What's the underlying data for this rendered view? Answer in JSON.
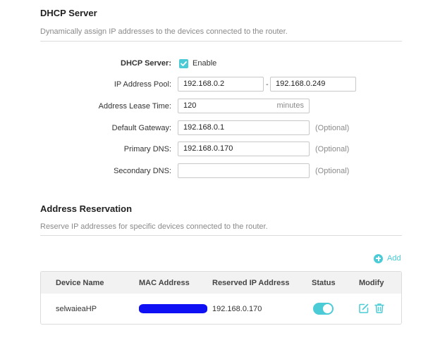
{
  "dhcp": {
    "title": "DHCP Server",
    "description": "Dynamically assign IP addresses to the devices connected to the router.",
    "server_label": "DHCP Server:",
    "enable_label": "Enable",
    "enabled": true,
    "pool_label": "IP Address Pool:",
    "pool_start": "192.168.0.2",
    "pool_dash": "-",
    "pool_end": "192.168.0.249",
    "lease_label": "Address Lease Time:",
    "lease_value": "120",
    "lease_unit": "minutes",
    "gateway_label": "Default Gateway:",
    "gateway_value": "192.168.0.1",
    "primary_dns_label": "Primary DNS:",
    "primary_dns_value": "192.168.0.170",
    "secondary_dns_label": "Secondary DNS:",
    "secondary_dns_value": "",
    "optional_label": "(Optional)"
  },
  "reservation": {
    "title": "Address Reservation",
    "description": "Reserve IP addresses for specific devices connected to the router.",
    "add_label": "Add",
    "columns": [
      "Device Name",
      "MAC Address",
      "Reserved IP Address",
      "Status",
      "Modify"
    ],
    "rows": [
      {
        "device_name": "selwaieaHP",
        "mac_address": "",
        "reserved_ip": "192.168.0.170",
        "status_on": true
      }
    ]
  },
  "colors": {
    "accent": "#4acbd6",
    "redaction": "#1010f5"
  },
  "icons": {
    "enable_checkbox": "check-icon",
    "add": "plus-circle-icon",
    "edit": "edit-icon",
    "delete": "trash-icon"
  }
}
